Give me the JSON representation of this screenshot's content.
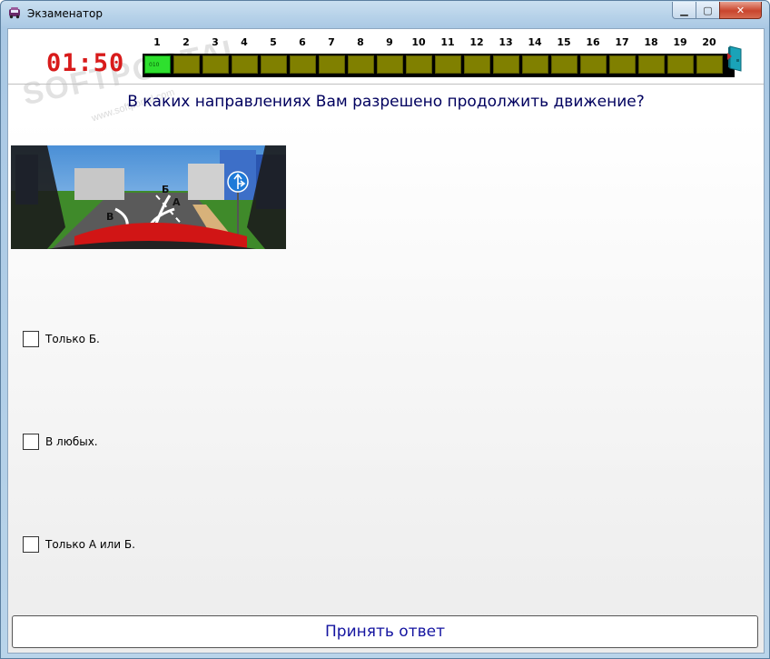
{
  "window": {
    "title": "Экзаменатор",
    "minimize_label": "▁",
    "maximize_label": "▢",
    "close_label": "✕"
  },
  "timer": {
    "value": "01:50"
  },
  "progress": {
    "question_numbers": [
      "1",
      "2",
      "3",
      "4",
      "5",
      "6",
      "7",
      "8",
      "9",
      "10",
      "11",
      "12",
      "13",
      "14",
      "15",
      "16",
      "17",
      "18",
      "19",
      "20"
    ],
    "current_index": 1,
    "current_cell_text": "010"
  },
  "question": {
    "text": "В каких направлениях Вам разрешено продолжить движение?"
  },
  "picture": {
    "labels": {
      "a": "А",
      "b": "Б",
      "v": "В"
    },
    "road_sign_icon": "straight-or-right-sign-icon"
  },
  "answers": [
    {
      "label": "Только Б.",
      "checked": false
    },
    {
      "label": "В любых.",
      "checked": false
    },
    {
      "label": "Только А или Б.",
      "checked": false
    }
  ],
  "accept_button": {
    "label": "Принять ответ"
  },
  "watermark": {
    "text": "SOFTPORTAL",
    "sub": "www.softportal.com"
  },
  "colors": {
    "question_text": "#00005e",
    "timer": "#d81b1b",
    "cell": "#808000",
    "current_cell": "#2ee02e",
    "accept_text": "#1414a0"
  }
}
